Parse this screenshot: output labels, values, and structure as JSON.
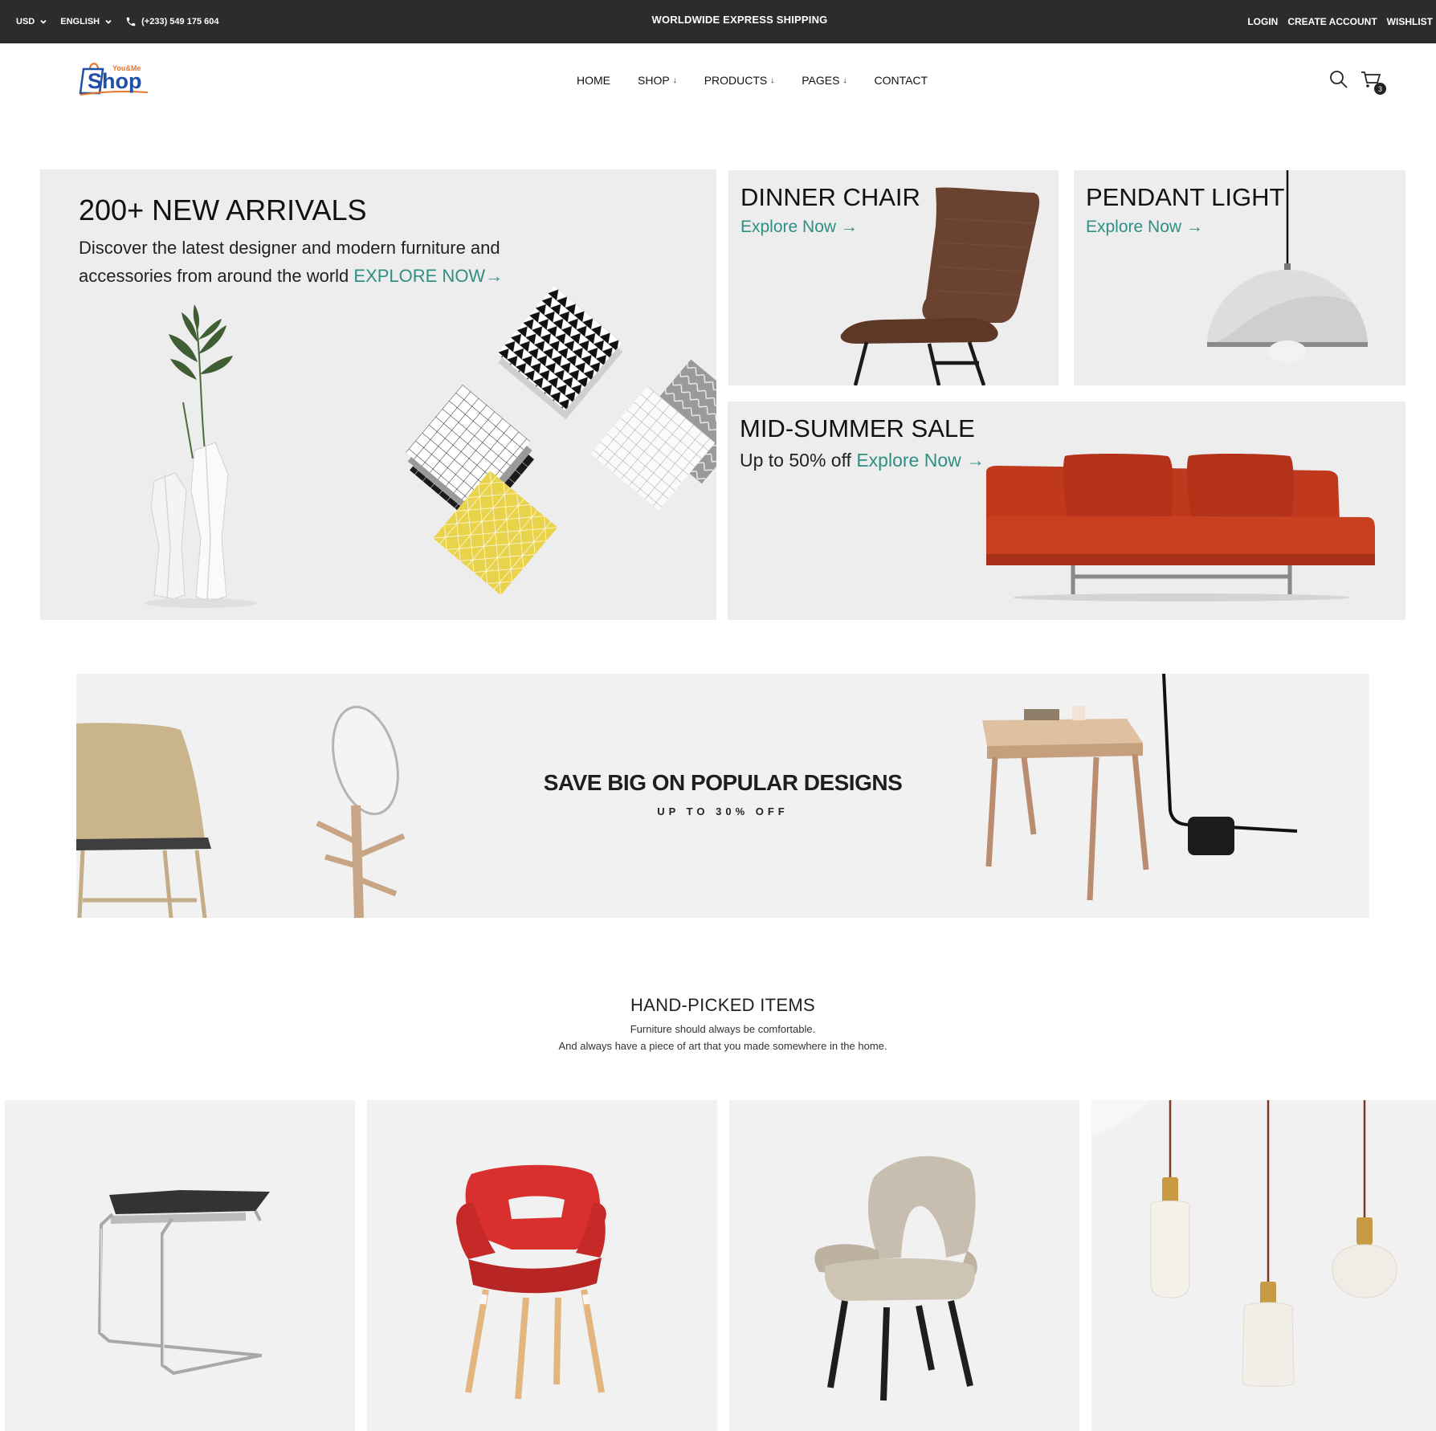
{
  "topbar": {
    "currency": "USD",
    "language": "ENGLISH",
    "phone": "(+233) 549 175 604",
    "announcement": "WORLDWIDE EXPRESS SHIPPING",
    "login": "LOGIN",
    "create_account": "CREATE ACCOUNT",
    "wishlist": "WISHLIST"
  },
  "logo": {
    "small_text": "You&Me",
    "main_text": "Shop"
  },
  "nav": {
    "items": [
      {
        "label": "HOME",
        "arrow": ""
      },
      {
        "label": "SHOP",
        "arrow": "↓"
      },
      {
        "label": "PRODUCTS",
        "arrow": "↓"
      },
      {
        "label": "PAGES",
        "arrow": "↓"
      },
      {
        "label": "CONTACT",
        "arrow": ""
      }
    ]
  },
  "cart": {
    "count": "3"
  },
  "hero": {
    "title": "200+ NEW ARRIVALS",
    "desc_line1": "Discover the latest designer and modern furniture and",
    "desc_line2": "accessories from around the world",
    "link": "EXPLORE NOW→"
  },
  "tiles": {
    "chair": {
      "title": "DINNER CHAIR",
      "link": "Explore Now →"
    },
    "lamp": {
      "title": "PENDANT LIGHT",
      "link": "Explore Now →"
    },
    "sale": {
      "title": "MID-SUMMER SALE",
      "subtitle": "Up to 50% off",
      "link": "Explore Now →"
    }
  },
  "banner": {
    "title": "SAVE BIG ON POPULAR DESIGNS",
    "subtitle": "UP TO 30% OFF"
  },
  "hand_picked": {
    "title": "HAND-PICKED ITEMS",
    "line1": "Furniture should always be comfortable.",
    "line2": "And always have a piece of art that you made somewhere in the home."
  },
  "colors": {
    "topbar": "#2c2c2c",
    "accent": "#2f8f83",
    "tile_bg": "#ededed",
    "logo_blue": "#1f4fa8",
    "logo_orange": "#e8742a"
  }
}
